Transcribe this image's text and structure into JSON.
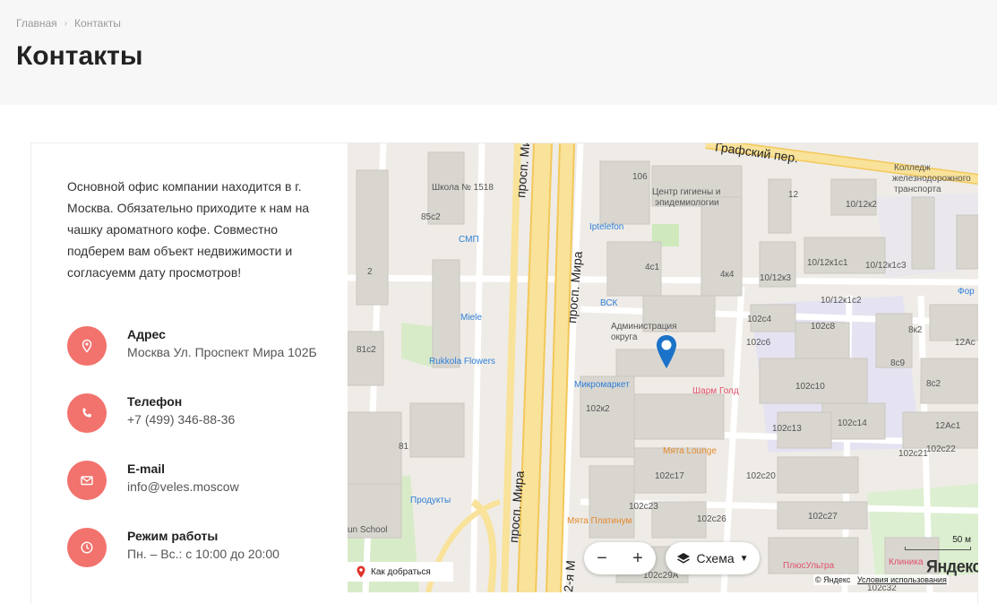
{
  "breadcrumb": {
    "home": "Главная",
    "current": "Контакты"
  },
  "page": {
    "title": "Контакты"
  },
  "intro": "Основной офис компании находится в г. Москва. Обязательно приходите к нам на чашку ароматного кофе. Совместно подберем вам объект недвижимости и согласуемм дату просмотров!",
  "contacts": {
    "address": {
      "label": "Адрес",
      "value": "Москва Ул. Проспект Мира 102Б",
      "icon": "location-pin-icon"
    },
    "phone": {
      "label": "Телефон",
      "value": "+7 (499) 346-88-36",
      "icon": "phone-icon"
    },
    "email": {
      "label": "E-mail",
      "value": "info@veles.moscow",
      "icon": "envelope-icon"
    },
    "hours": {
      "label": "Режим работы",
      "value": "Пн. – Вс.: с 10:00 до 20:00",
      "icon": "clock-icon"
    }
  },
  "colors": {
    "accent": "#f2726d",
    "header_bg": "#f7f7f7",
    "map_bg": "#efece7",
    "road_major": "#f7d77b",
    "building": "#d9d6d0"
  },
  "map": {
    "roads": {
      "prospekt1": "просп. Мира",
      "prospekt2": "просп. Мира",
      "prospekt3": "просп. Мира",
      "prospekt4": "2-я М",
      "grafsky": "Графский пер."
    },
    "labels": {
      "school": "Школа № 1518",
      "b106": "106",
      "center": "Центр гигиены и",
      "center2": "эпидемиологии",
      "college": "Колледж",
      "college2": "железнодорожного",
      "college3": "транспорта",
      "b85c2": "85с2",
      "smp": "СМП",
      "iptelefon": "Iptelefon",
      "b12": "12",
      "b10_12k2": "10/12к2",
      "b2": "2",
      "b4c1": "4с1",
      "b4k4": "4к4",
      "b10_12k3": "10/12к3",
      "b10_12k1c1": "10/12к1с1",
      "b10_12k1c3": "10/12к1с3",
      "bck": "ВСК",
      "miele": "Miele",
      "admin": "Администрация",
      "admin2": "округа",
      "b10_12k1c2": "10/12к1с2",
      "b102c4": "102с4",
      "b102c8": "102с8",
      "b8k2": "8к2",
      "b81c2": "81с2",
      "rukkola": "Rukkola Flowers",
      "b102c6": "102с6",
      "b8c9": "8с9",
      "b12ac": "12Ас",
      "mikromarket": "Микромаркет",
      "sharm": "Шарм Голд",
      "b102c10": "102с10",
      "b8c2": "8с2",
      "b102k2": "102к2",
      "b102c13": "102с13",
      "b102c14": "102с14",
      "b12ac1": "12Ас1",
      "myata_lounge": "Мята Lounge",
      "b81": "81",
      "b102c22": "102с22",
      "b102c21": "102с21",
      "b102c17": "102с17",
      "b102c20": "102с20",
      "produkty": "Продукты",
      "b102c23": "102с23",
      "b102c26": "102с26",
      "myata_platinum": "Мята Платинум",
      "b102c27": "102с27",
      "school2": "un School",
      "plusultra": "ПлюсУльтра",
      "klinika": "Клиника",
      "b102c29a": "102с29А",
      "b102c32": "102с32",
      "b12_partial": "12",
      "for": "Фор"
    },
    "zoom_in": "+",
    "zoom_out": "−",
    "scheme_label": "Схема",
    "route_label": "Как добраться",
    "scale_label": "50 м",
    "logo": "Яндекс",
    "copyright": "© Яндекс",
    "terms": "Условия использования"
  }
}
